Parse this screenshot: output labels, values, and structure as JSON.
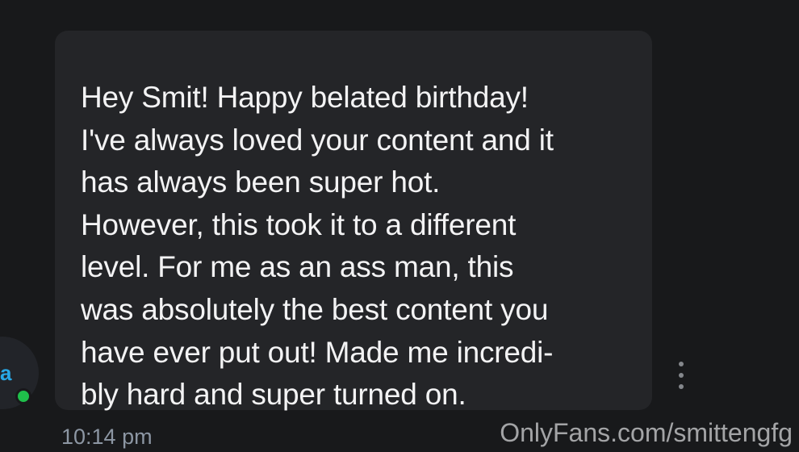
{
  "chat": {
    "sender": {
      "avatar_letter": "a",
      "status": "online",
      "status_color": "#1fbf4b",
      "avatar_letter_color": "#28a8e6"
    },
    "message": {
      "text": "Hey Smit! Happy belated birthday!\nI've always loved your content and it\nhas always been super hot.\nHowever, this took it to a different\nlevel. For me as an ass man, this\nwas absolutely the best content you\nhave ever put out! Made me incredi-\nbly hard and super turned on.",
      "timestamp": "10:14 pm",
      "bubble_color": "#242528"
    },
    "more_icon": "vertical-dots-icon"
  },
  "watermark": {
    "text": "OnlyFans.com/smittengfg"
  },
  "colors": {
    "background": "#18191b",
    "message_text": "#f3f3f4",
    "timestamp_text": "#8c96a3"
  }
}
